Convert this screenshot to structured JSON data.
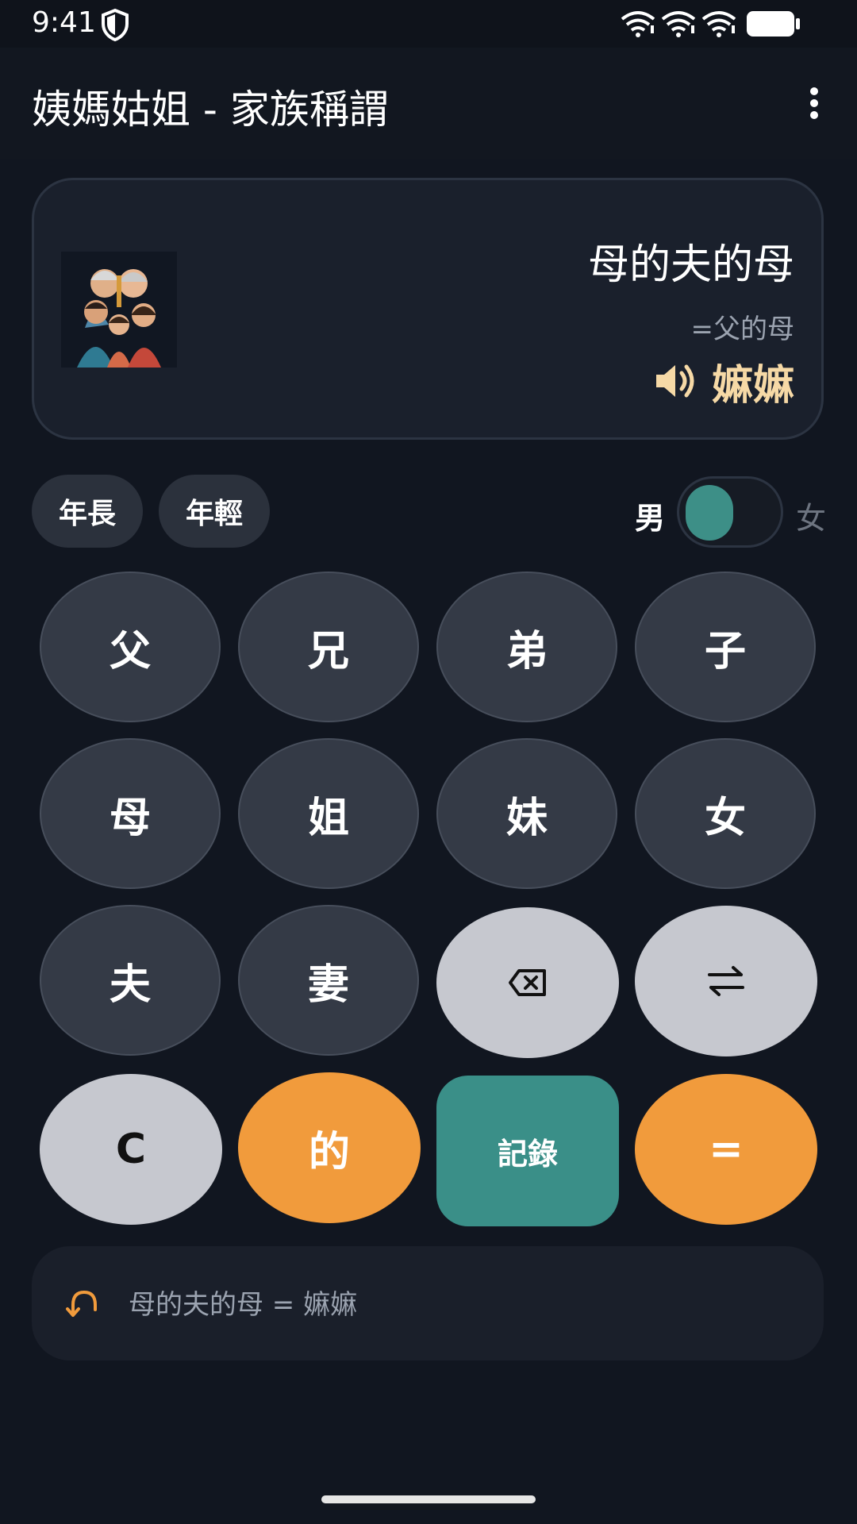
{
  "status_bar": {
    "time": "9:41",
    "icons": [
      "shield-icon",
      "wifi-icon",
      "wifi-icon",
      "wifi-icon",
      "battery-icon"
    ]
  },
  "app_bar": {
    "title": "姨媽姑姐 - 家族稱謂",
    "menu_icon": "more-vert-icon"
  },
  "display": {
    "avatar_icon": "family-portrait-icon",
    "expression": "母的夫的母",
    "equivalent": "=父的母",
    "speaker_icon": "speaker-icon",
    "result": "嫲嫲",
    "result_color": "#f6d9a6"
  },
  "options": {
    "older_label": "年長",
    "younger_label": "年輕",
    "male_label": "男",
    "female_label": "女",
    "selected_gender": "男"
  },
  "keypad": {
    "row1": [
      "父",
      "兄",
      "弟",
      "子"
    ],
    "row2": [
      "母",
      "姐",
      "妹",
      "女"
    ],
    "row3": [
      "夫",
      "妻"
    ],
    "backspace_icon": "backspace-icon",
    "swap_icon": "swap-arrows-icon",
    "clear_label": "C",
    "of_label": "的",
    "record_label": "記錄",
    "equals_label": "="
  },
  "history": {
    "icon": "undo-icon",
    "text": "母的夫的母 = 嫲嫲"
  },
  "colors": {
    "background": "#111620",
    "accent_orange": "#f19b3c",
    "accent_teal": "#3a8f88",
    "key_dark": "#343a46",
    "key_light": "#c6c8cf"
  }
}
